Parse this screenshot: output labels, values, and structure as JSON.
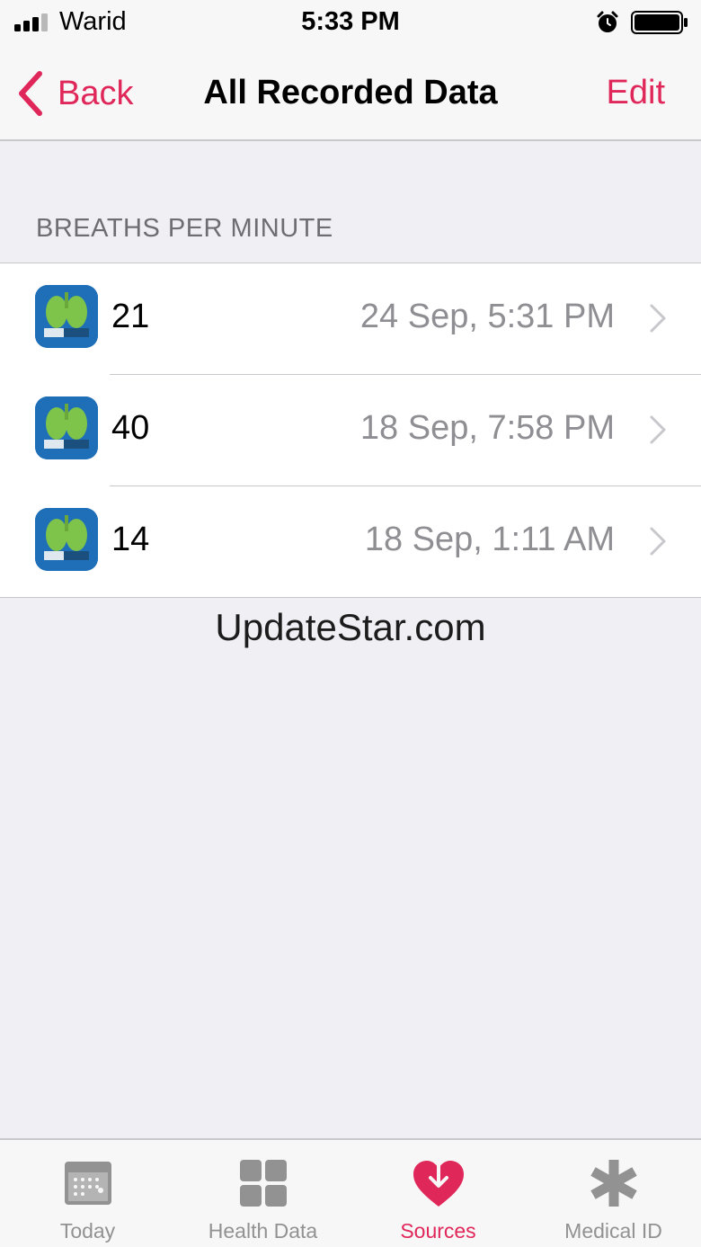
{
  "status_bar": {
    "carrier": "Warid",
    "time": "5:33 PM",
    "alarm_icon": "alarm-clock-icon",
    "battery_icon": "battery-full-icon"
  },
  "nav": {
    "back_label": "Back",
    "title": "All Recorded Data",
    "edit_label": "Edit"
  },
  "section": {
    "header": "BREATHS PER MINUTE"
  },
  "records": [
    {
      "value": "21",
      "date": "24 Sep, 5:31 PM"
    },
    {
      "value": "40",
      "date": "18 Sep, 7:58 PM"
    },
    {
      "value": "14",
      "date": "18 Sep, 1:11 AM"
    }
  ],
  "watermark": "UpdateStar.com",
  "tabs": [
    {
      "label": "Today",
      "icon": "calendar-icon",
      "active": false
    },
    {
      "label": "Health Data",
      "icon": "grid-icon",
      "active": false
    },
    {
      "label": "Sources",
      "icon": "heart-arrow-icon",
      "active": true
    },
    {
      "label": "Medical ID",
      "icon": "asterisk-icon",
      "active": false
    }
  ],
  "colors": {
    "accent": "#e0275a",
    "background": "#efeff4",
    "secondary_text": "#8e8e93",
    "tab_inactive": "#929292",
    "app_icon": "#1f6fb8"
  }
}
